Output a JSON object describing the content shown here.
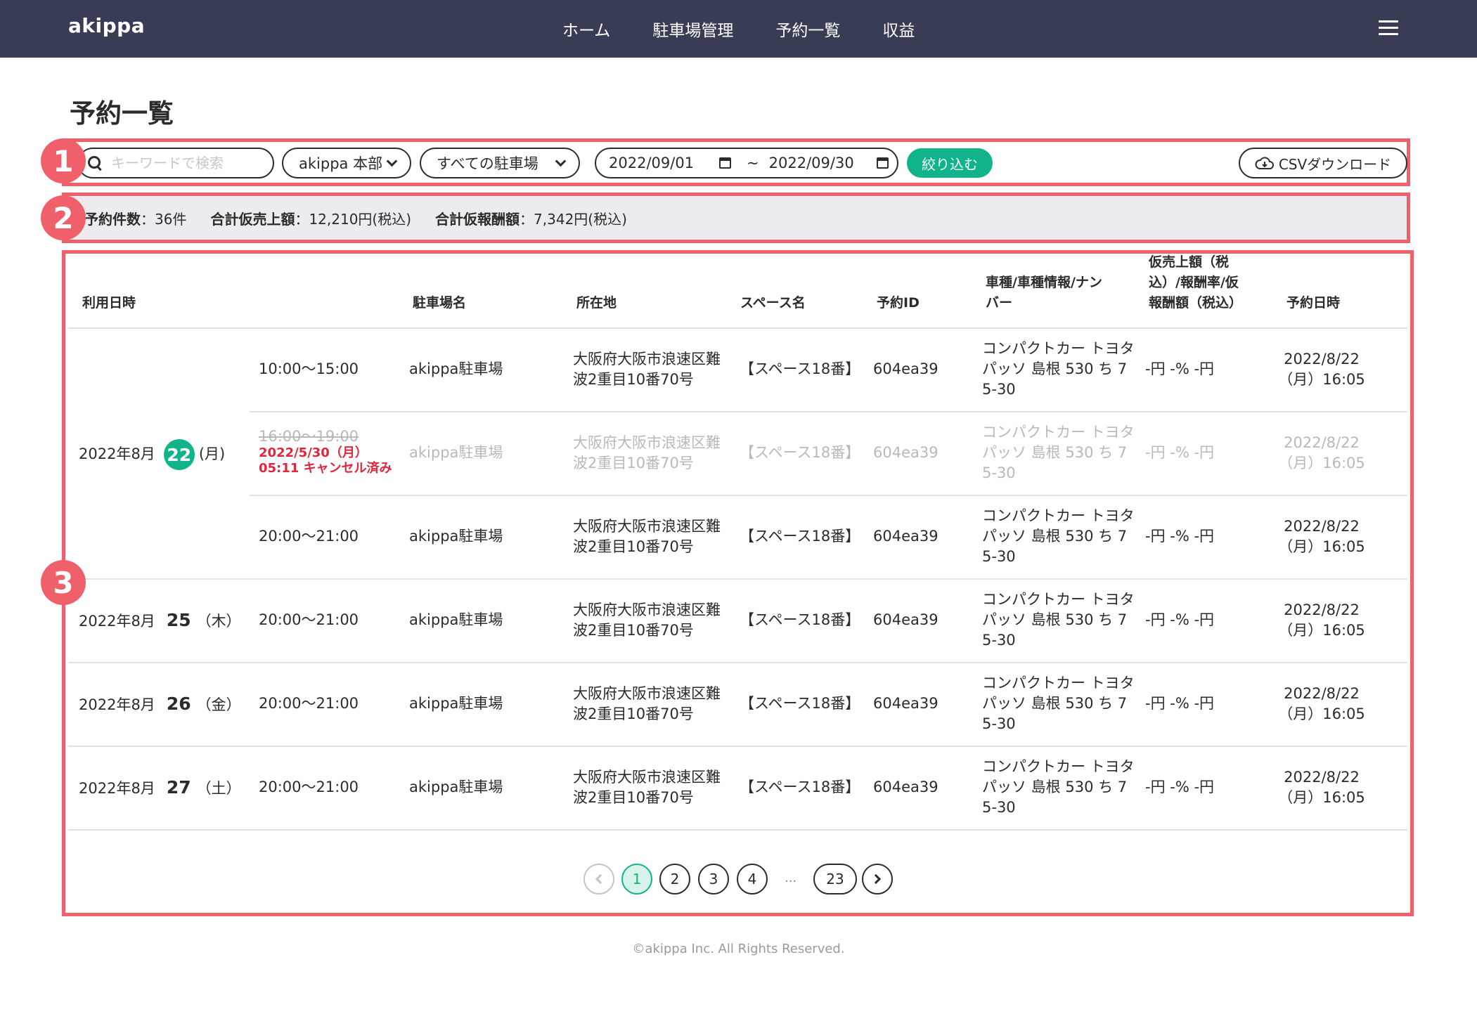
{
  "header": {
    "brand": "akippa",
    "nav": [
      "ホーム",
      "駐車場管理",
      "予約一覧",
      "収益"
    ]
  },
  "page": {
    "title": "予約一覧"
  },
  "toolbar": {
    "search_placeholder": "キーワードで検索",
    "org_select": "akippa 本部",
    "lot_select": "すべての駐車場",
    "date_from": "2022/09/01",
    "tilde": "~",
    "date_to": "2022/09/30",
    "filter_label": "絞り込む",
    "csv_label": "CSVダウンロード"
  },
  "summary": {
    "count_label": "予約件数",
    "count_value": "：36件",
    "sales_label": "合計仮売上額",
    "sales_value": "：12,210円(税込)",
    "reward_label": "合計仮報酬額",
    "reward_value": "：7,342円(税込)"
  },
  "callouts": [
    "1",
    "2",
    "3"
  ],
  "table": {
    "headers": {
      "date": "利用日時",
      "lot": "駐車場名",
      "address": "所在地",
      "space": "スペース名",
      "id": "予約ID",
      "car": [
        "車種/車種情報/ナン",
        "バー"
      ],
      "amount": [
        "仮売上額（税",
        "込）/報酬率/仮",
        "報酬額（税込）"
      ],
      "booked": "予約日時"
    },
    "common": {
      "lot": "akippa駐車場",
      "address": [
        "大阪府大阪市浪速区難",
        "波2重目10番70号"
      ],
      "space": "【スペース18番】",
      "id": "604ea39",
      "car": [
        "コンパクトカー トヨタ",
        "パッソ 島根 530 ち 7",
        "5-30"
      ],
      "amount": "-円 -% -円",
      "booked": [
        "2022/8/22",
        "（月）16:05"
      ]
    },
    "group1": {
      "date_prefix": "2022年8月",
      "day": "22",
      "weekday": "(月)",
      "rows": [
        {
          "time": "10:00〜15:00"
        },
        {
          "time": "16:00〜19:00",
          "cancel_line1": "2022/5/30（月）",
          "cancel_line2": "05:11 キャンセル済み"
        },
        {
          "time": "20:00〜21:00"
        }
      ]
    },
    "rows": [
      {
        "date_prefix": "2022年8月",
        "day": "25",
        "weekday": "（木）",
        "time": "20:00〜21:00"
      },
      {
        "date_prefix": "2022年8月",
        "day": "26",
        "weekday": "（金）",
        "time": "20:00〜21:00"
      },
      {
        "date_prefix": "2022年8月",
        "day": "27",
        "weekday": "（土）",
        "time": "20:00〜21:00"
      }
    ]
  },
  "pagination": {
    "pages": [
      "1",
      "2",
      "3",
      "4",
      "23"
    ],
    "ellipsis": "...",
    "current": 1
  },
  "footer": "©akippa Inc. All Rights Reserved."
}
